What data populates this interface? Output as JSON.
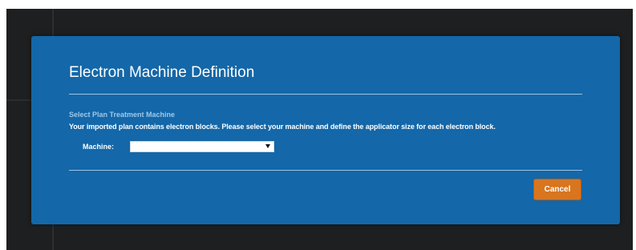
{
  "dialog": {
    "title": "Electron Machine Definition",
    "section_title": "Select Plan Treatment Machine",
    "instructions": "Your imported plan contains electron blocks. Please select your machine and define the applicator size for each electron block.",
    "machine": {
      "label": "Machine:",
      "selected_value": "",
      "icon": "chevron-down-icon"
    },
    "cancel_label": "Cancel"
  },
  "colors": {
    "dialog_background": "#1467a8",
    "app_background": "#1d1f21",
    "section_title": "#9ec8ea",
    "cancel_button": "#d9751e"
  }
}
